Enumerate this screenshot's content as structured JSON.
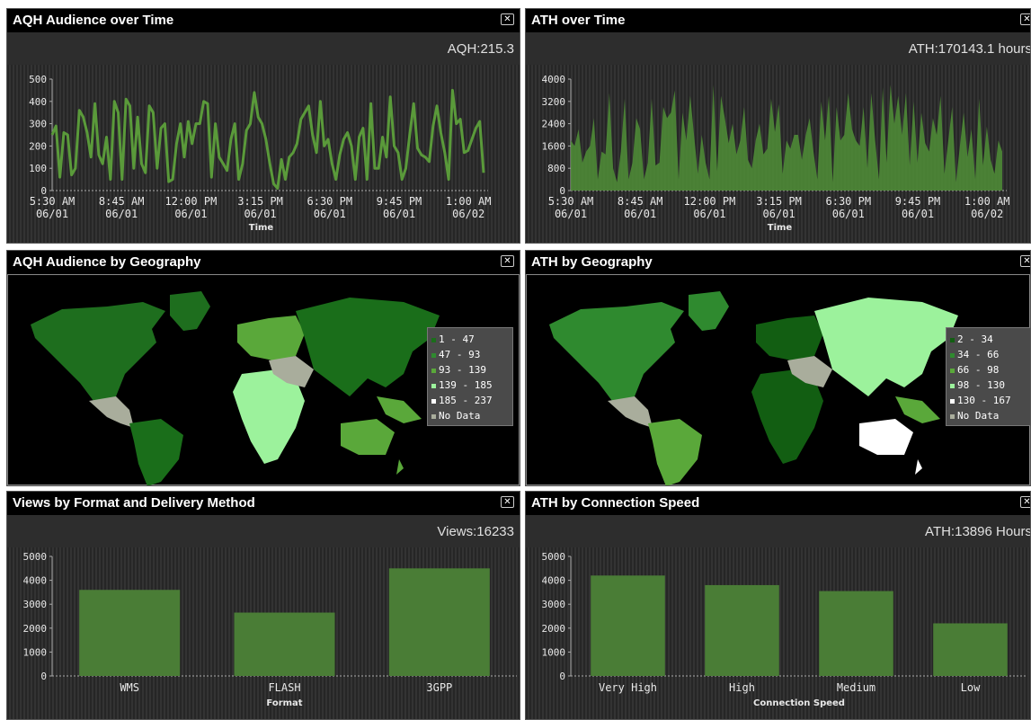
{
  "colors": {
    "line": "#5a9a3a",
    "bar": "#4a7d36",
    "area": "#4e8a36"
  },
  "panels": {
    "aqh_time": {
      "title": "AQH Audience over Time",
      "summary": "AQH:215.3",
      "close": "✕"
    },
    "ath_time": {
      "title": "ATH over Time",
      "summary": "ATH:170143.1 hours",
      "close": "✕"
    },
    "aqh_geo": {
      "title": "AQH Audience by Geography",
      "close": "✕"
    },
    "ath_geo": {
      "title": "ATH by Geography",
      "close": "✕"
    },
    "views_format": {
      "title": "Views by Format and Delivery Method",
      "summary": "Views:16233",
      "close": "✕"
    },
    "ath_speed": {
      "title": "ATH by Connection Speed",
      "summary": "ATH:13896 Hours",
      "close": "✕"
    }
  },
  "legends": {
    "aqh_geo": [
      {
        "label": "1 - 47",
        "color": "#1a6e1a"
      },
      {
        "label": "47 - 93",
        "color": "#2f8a2f"
      },
      {
        "label": "93 - 139",
        "color": "#5aa83a"
      },
      {
        "label": "139 - 185",
        "color": "#9cf29c"
      },
      {
        "label": "185 - 237",
        "color": "#ffffff"
      },
      {
        "label": "No Data",
        "color": "#a9ad9c"
      }
    ],
    "ath_geo": [
      {
        "label": "2 - 34",
        "color": "#125e12"
      },
      {
        "label": "34 - 66",
        "color": "#2f8a2f"
      },
      {
        "label": "66 - 98",
        "color": "#5aa83a"
      },
      {
        "label": "98 - 130",
        "color": "#9cf29c"
      },
      {
        "label": "130 - 167",
        "color": "#ffffff"
      },
      {
        "label": "No Data",
        "color": "#a9ad9c"
      }
    ]
  },
  "chart_data": [
    {
      "id": "aqh_time",
      "type": "line",
      "title": "AQH Audience over Time",
      "xlabel": "Time",
      "ylabel": "",
      "ylim": [
        0,
        500
      ],
      "yticks": [
        0,
        100,
        200,
        300,
        400,
        500
      ],
      "xticks": [
        {
          "time": "5:30 AM",
          "date": "06/01"
        },
        {
          "time": "8:45 AM",
          "date": "06/01"
        },
        {
          "time": "12:00 PM",
          "date": "06/01"
        },
        {
          "time": "3:15 PM",
          "date": "06/01"
        },
        {
          "time": "6:30 PM",
          "date": "06/01"
        },
        {
          "time": "9:45 PM",
          "date": "06/01"
        },
        {
          "time": "1:00 AM",
          "date": "06/02"
        }
      ],
      "values": [
        250,
        290,
        60,
        260,
        250,
        70,
        100,
        360,
        330,
        260,
        150,
        390,
        160,
        120,
        240,
        50,
        400,
        350,
        50,
        410,
        380,
        100,
        330,
        120,
        80,
        380,
        350,
        100,
        280,
        300,
        40,
        50,
        210,
        300,
        150,
        310,
        210,
        300,
        300,
        400,
        390,
        60,
        300,
        150,
        120,
        90,
        230,
        300,
        50,
        120,
        270,
        300,
        440,
        330,
        300,
        230,
        120,
        30,
        10,
        140,
        50,
        150,
        170,
        210,
        320,
        350,
        380,
        250,
        170,
        400,
        200,
        230,
        120,
        50,
        160,
        230,
        260,
        200,
        50,
        240,
        280,
        50,
        390,
        100,
        100,
        240,
        150,
        420,
        200,
        170,
        50,
        100,
        250,
        390,
        190,
        160,
        150,
        130,
        290,
        380,
        260,
        170,
        50,
        450,
        300,
        320,
        170,
        180,
        230,
        280,
        310,
        80
      ]
    },
    {
      "id": "ath_time",
      "type": "area",
      "title": "ATH over Time",
      "xlabel": "Time",
      "ylabel": "",
      "ylim": [
        0,
        4000
      ],
      "yticks": [
        0,
        800,
        1600,
        2400,
        3200,
        4000
      ],
      "xticks": [
        {
          "time": "5:30 AM",
          "date": "06/01"
        },
        {
          "time": "8:45 AM",
          "date": "06/01"
        },
        {
          "time": "12:00 PM",
          "date": "06/01"
        },
        {
          "time": "3:15 PM",
          "date": "06/01"
        },
        {
          "time": "6:30 PM",
          "date": "06/01"
        },
        {
          "time": "9:45 PM",
          "date": "06/01"
        },
        {
          "time": "1:00 AM",
          "date": "06/02"
        }
      ],
      "values": [
        1800,
        1600,
        2200,
        1000,
        1400,
        1600,
        2600,
        400,
        1400,
        1300,
        3500,
        800,
        300,
        1400,
        3300,
        400,
        1000,
        2600,
        2200,
        400,
        1000,
        3300,
        900,
        1000,
        3000,
        2600,
        2800,
        3600,
        400,
        2800,
        1800,
        3400,
        2000,
        600,
        2000,
        1000,
        400,
        3800,
        700,
        3400,
        2600,
        1700,
        2400,
        1300,
        1800,
        3000,
        1100,
        800,
        1800,
        2400,
        1300,
        1500,
        3300,
        2100,
        3100,
        600,
        1800,
        1500,
        2000,
        2000,
        1100,
        2000,
        2600,
        1400,
        400,
        3200,
        1800,
        3400,
        300,
        3000,
        1800,
        2000,
        3500,
        2200,
        1800,
        1600,
        3000,
        800,
        3500,
        1800,
        400,
        3700,
        1000,
        3800,
        2400,
        3400,
        2000,
        3500,
        900,
        3200,
        1000,
        2800,
        1700,
        1400,
        2600,
        2000,
        3400,
        600,
        1800,
        3000,
        300,
        1600,
        2800,
        1200,
        2200,
        400,
        3300,
        900,
        2300,
        1100,
        600,
        1800,
        1400
      ]
    },
    {
      "id": "views_format",
      "type": "bar",
      "title": "Views by Format and Delivery Method",
      "xlabel": "Format",
      "ylabel": "",
      "ylim": [
        0,
        5000
      ],
      "yticks": [
        0,
        1000,
        2000,
        3000,
        4000,
        5000
      ],
      "categories": [
        "WMS",
        "FLASH",
        "3GPP"
      ],
      "values": [
        3600,
        2650,
        4500
      ]
    },
    {
      "id": "ath_speed",
      "type": "bar",
      "title": "ATH by Connection Speed",
      "xlabel": "Connection Speed",
      "ylabel": "",
      "ylim": [
        0,
        5000
      ],
      "yticks": [
        0,
        1000,
        2000,
        3000,
        4000,
        5000
      ],
      "categories": [
        "Very High",
        "High",
        "Medium",
        "Low"
      ],
      "values": [
        4200,
        3800,
        3550,
        2200
      ]
    }
  ]
}
